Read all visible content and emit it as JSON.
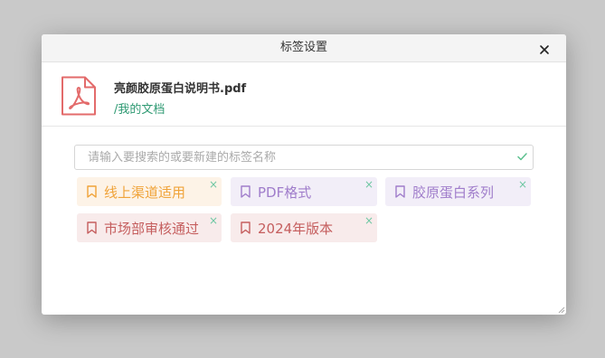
{
  "dialog": {
    "title": "标签设置"
  },
  "file": {
    "name": "亮颜胶原蛋白说明书.pdf",
    "path": "/我的文档",
    "icon": "pdf-icon",
    "icon_color": "#e36b6b"
  },
  "search": {
    "placeholder": "请输入要搜索的或要新建的标签名称",
    "value": ""
  },
  "tags": [
    {
      "label": "线上渠道适用",
      "color": "orange",
      "remove": "×"
    },
    {
      "label": "PDF格式",
      "color": "purple",
      "remove": "×"
    },
    {
      "label": "胶原蛋白系列",
      "color": "purple",
      "remove": "×"
    },
    {
      "label": "市场部审核通过",
      "color": "red",
      "remove": "×"
    },
    {
      "label": "2024年版本",
      "color": "red",
      "remove": "×"
    }
  ],
  "colors": {
    "accent": "#2f9a73",
    "orange": "#f0a339",
    "purple": "#a07dcb",
    "red": "#c55e5e"
  }
}
